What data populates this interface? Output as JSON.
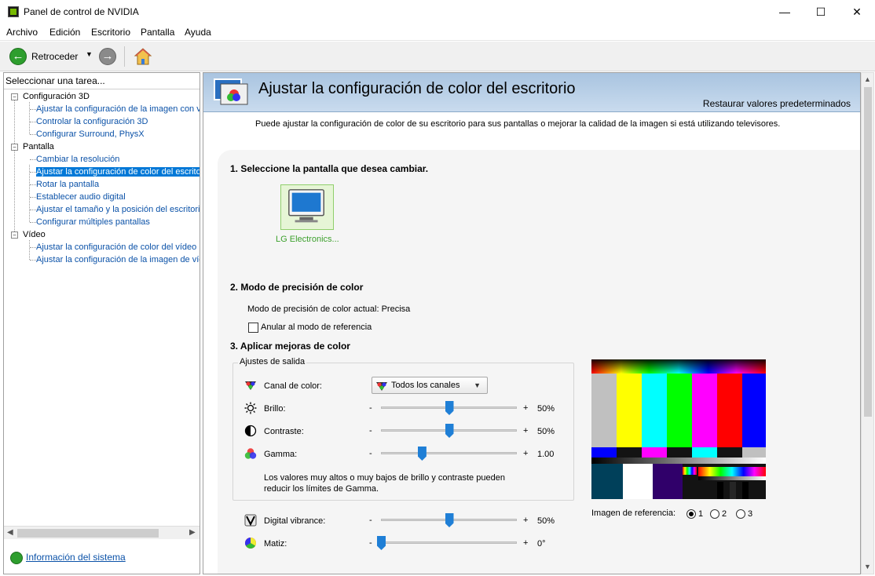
{
  "window": {
    "title": "Panel de control de NVIDIA",
    "minimize": "—",
    "maximize": "☐",
    "close": "✕"
  },
  "menu": [
    "Archivo",
    "Edición",
    "Escritorio",
    "Pantalla",
    "Ayuda"
  ],
  "toolbar": {
    "back_label": "Retroceder"
  },
  "sidebar": {
    "task_label": "Seleccionar una tarea...",
    "categories": [
      {
        "label": "Configuración 3D",
        "items": [
          "Ajustar la configuración de la imagen con v",
          "Controlar la configuración 3D",
          "Configurar Surround, PhysX"
        ]
      },
      {
        "label": "Pantalla",
        "items": [
          "Cambiar la resolución",
          "Ajustar la configuración de color del escrito",
          "Rotar la pantalla",
          "Establecer audio digital",
          "Ajustar el tamaño y la posición del escritori",
          "Configurar múltiples pantallas"
        ]
      },
      {
        "label": "Vídeo",
        "items": [
          "Ajustar la configuración de color del vídeo",
          "Ajustar la configuración de la imagen de víd"
        ]
      }
    ],
    "selected": "Ajustar la configuración de color del escrito",
    "system_info": "Información del sistema"
  },
  "content": {
    "title": "Ajustar la configuración de color del escritorio",
    "restore": "Restaurar valores predeterminados",
    "intro": "Puede ajustar la configuración de color de su escritorio para sus pantallas o mejorar la calidad de la imagen si está utilizando televisores.",
    "section1": "1. Seleccione la pantalla que desea cambiar.",
    "display_name": "LG Electronics...",
    "section2": "2. Modo de precisión de color",
    "precision_current": "Modo de precisión de color actual: Precisa",
    "override_label": "Anular al modo de referencia",
    "section3": "3. Aplicar mejoras de color",
    "group_title": "Ajustes de salida",
    "channel_label": "Canal de color:",
    "channel_value": "Todos los canales",
    "minus": "-",
    "plus": "+",
    "sliders": [
      {
        "label": "Brillo:",
        "value_text": "50%",
        "fraction": 0.5
      },
      {
        "label": "Contraste:",
        "value_text": "50%",
        "fraction": 0.5
      },
      {
        "label": "Gamma:",
        "value_text": "1.00",
        "fraction": 0.3
      },
      {
        "label": "Digital vibrance:",
        "value_text": "50%",
        "fraction": 0.5
      },
      {
        "label": "Matiz:",
        "value_text": "0°",
        "fraction": 0.0
      }
    ],
    "warning": "Los valores muy altos o muy bajos de brillo y contraste pueden reducir los límites de Gamma.",
    "reference_label": "Imagen de referencia:",
    "reference_options": [
      "1",
      "2",
      "3"
    ],
    "reference_selected": "1"
  },
  "colors": {
    "accent": "#0078d7",
    "nvidia_green": "#76b900",
    "link": "#0b52a8",
    "slider_thumb": "#1f7fd6"
  }
}
